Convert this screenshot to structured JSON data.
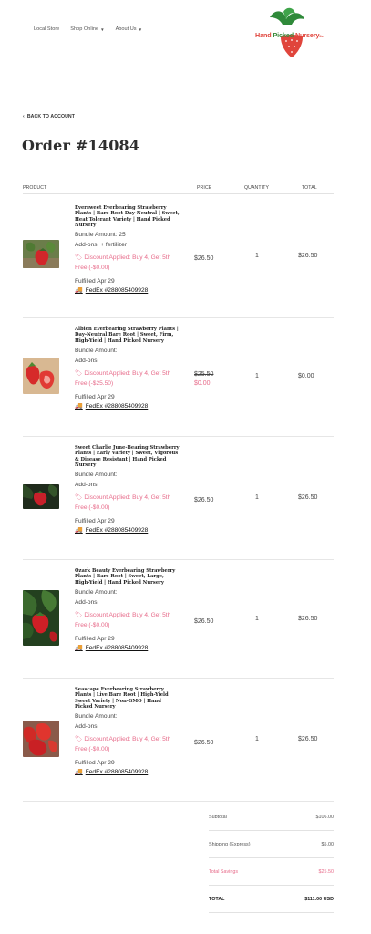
{
  "nav": {
    "items": [
      {
        "label": "Local Store",
        "dropdown": false
      },
      {
        "label": "Shop Online",
        "dropdown": true
      },
      {
        "label": "About Us",
        "dropdown": true
      }
    ]
  },
  "logo": {
    "part1": "Hand ",
    "part2": "Picked",
    "part3": " Nursery",
    "suffix": "llc"
  },
  "back_link": "BACK TO ACCOUNT",
  "order_title": "Order #14084",
  "table": {
    "headers": {
      "product": "PRODUCT",
      "price": "PRICE",
      "quantity": "QUANTITY",
      "total": "TOTAL"
    },
    "rows": [
      {
        "title": "Eversweet Everbearing Strawberry Plants | Bare Root Day-Neutral | Sweet, Heat Tolerant Variety | Hand Picked Nursery",
        "bundle": "Bundle Amount: 25",
        "addons": "Add-ons: + fertilizer",
        "discount": "Discount Applied: Buy 4, Get 5th Free (-$0.00)",
        "fulfilled": "Fulfilled Apr 29",
        "tracking": "FedEx #288085409928",
        "price": "$26.50",
        "old_price": "",
        "quantity": "1",
        "total": "$26.50"
      },
      {
        "title": "Albion Everbearing Strawberry Plants | Day-Neutral Bare Root | Sweet, Firm, High-Yield | Hand Picked Nursery",
        "bundle": "Bundle Amount:",
        "addons": "Add-ons:",
        "discount": "Discount Applied: Buy 4, Get 5th Free (-$25.50)",
        "fulfilled": "Fulfilled Apr 29",
        "tracking": "FedEx #288085409928",
        "price": "$0.00",
        "old_price": "$25.50",
        "quantity": "1",
        "total": "$0.00"
      },
      {
        "title": "Sweet Charlie June-Bearing Strawberry Plants | Early Variety | Sweet, Vigorous & Disease Resistant | Hand Picked Nursery",
        "bundle": "Bundle Amount:",
        "addons": "Add-ons:",
        "discount": "Discount Applied: Buy 4, Get 5th Free (-$0.00)",
        "fulfilled": "Fulfilled Apr 29",
        "tracking": "FedEx #288085409928",
        "price": "$26.50",
        "old_price": "",
        "quantity": "1",
        "total": "$26.50"
      },
      {
        "title": "Ozark Beauty Everbearing Strawberry Plants | Bare Root | Sweet, Large, High-Yield | Hand Picked Nursery",
        "bundle": "Bundle Amount:",
        "addons": "Add-ons:",
        "discount": "Discount Applied: Buy 4, Get 5th Free (-$0.00)",
        "fulfilled": "Fulfilled Apr 29",
        "tracking": "FedEx #288085409928",
        "price": "$26.50",
        "old_price": "",
        "quantity": "1",
        "total": "$26.50"
      },
      {
        "title": "Seascape Everbearing Strawberry Plants | Live Bare Root | High-Yield Sweet Variety | Non-GMO | Hand Picked Nursery",
        "bundle": "Bundle Amount:",
        "addons": "Add-ons:",
        "discount": "Discount Applied: Buy 4, Get 5th Free (-$0.00)",
        "fulfilled": "Fulfilled Apr 29",
        "tracking": "FedEx #288085409928",
        "price": "$26.50",
        "old_price": "",
        "quantity": "1",
        "total": "$26.50"
      }
    ]
  },
  "summary": {
    "subtotal_label": "Subtotal",
    "subtotal_value": "$106.00",
    "shipping_label": "Shipping (Express)",
    "shipping_value": "$5.00",
    "savings_label": "Total Savings",
    "savings_value": "$25.50",
    "total_label": "TOTAL",
    "total_value": "$111.00 USD"
  },
  "colors": {
    "discount": "#e76b8a",
    "brand_red": "#e0453c",
    "brand_green": "#3a8a3a"
  }
}
